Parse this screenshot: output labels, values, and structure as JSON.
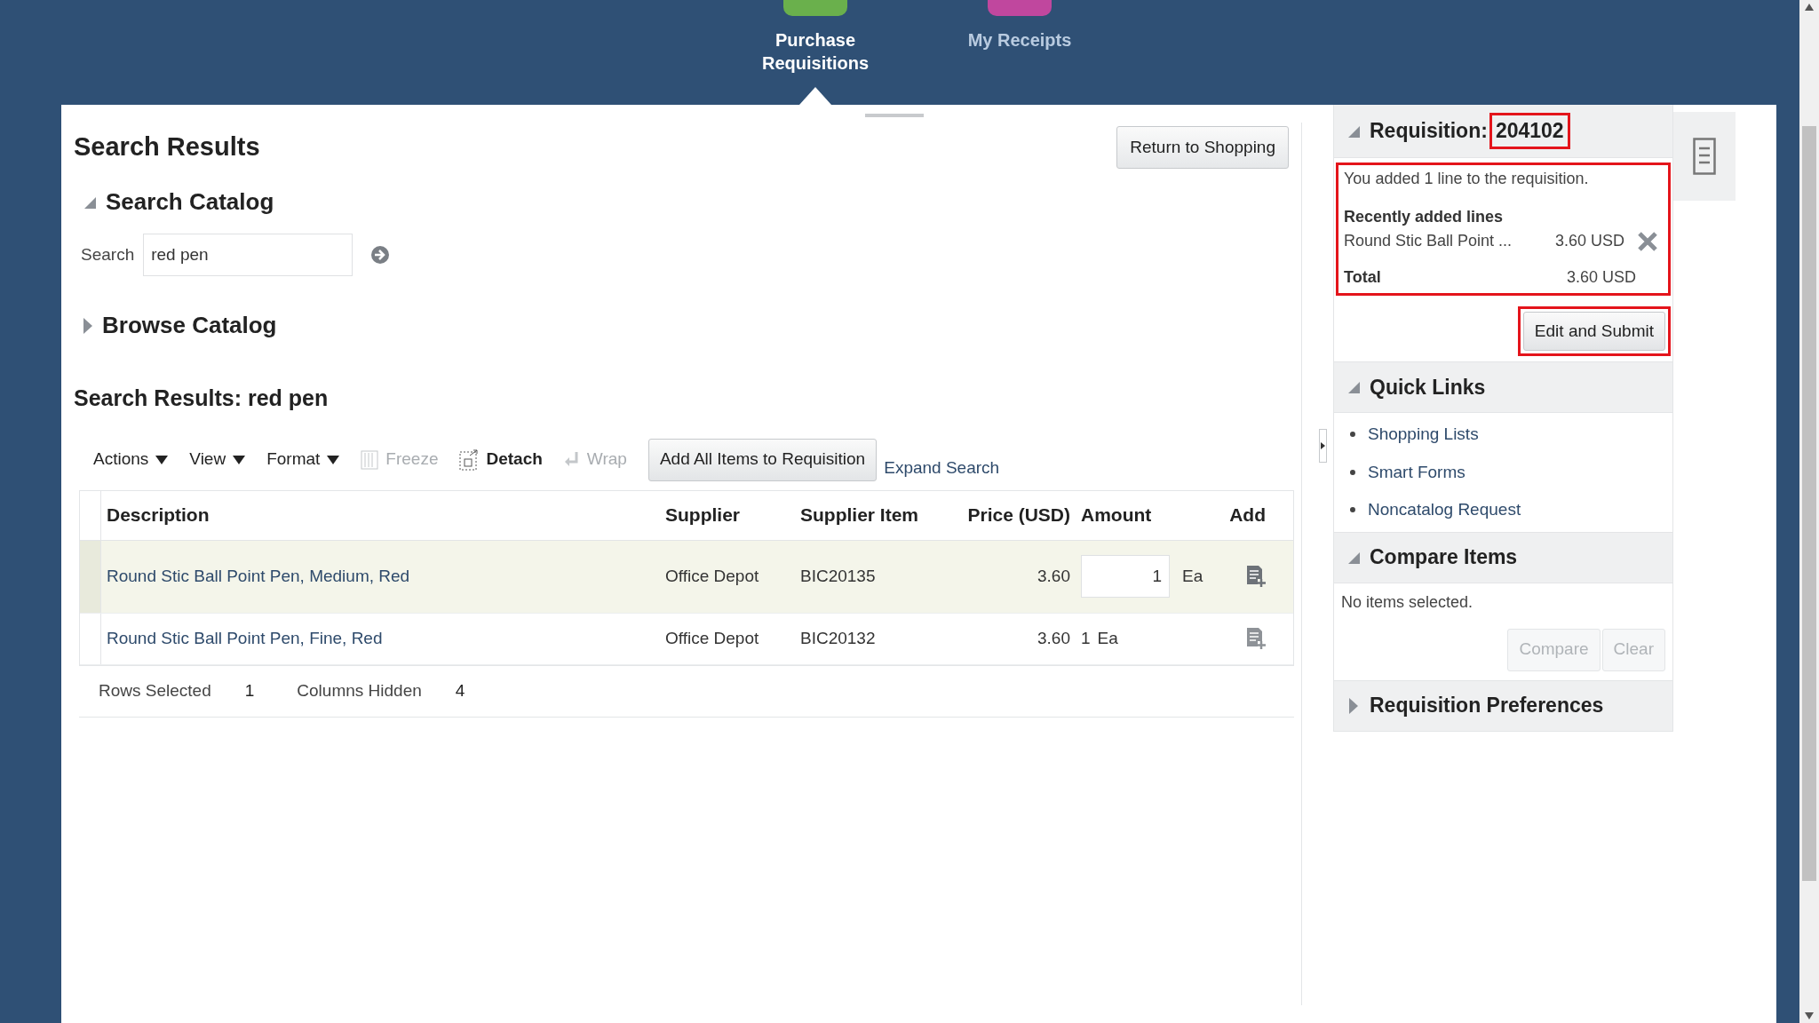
{
  "nav": {
    "items": [
      {
        "label": "Purchase Requisitions",
        "selected": true,
        "color": "#6ab04c"
      },
      {
        "label": "My Receipts",
        "selected": false,
        "color": "#c0479e"
      }
    ]
  },
  "main": {
    "title": "Search Results",
    "return_button": "Return to Shopping",
    "search_catalog": {
      "title": "Search Catalog",
      "expanded": true,
      "label": "Search",
      "value": "red pen"
    },
    "browse_catalog": {
      "title": "Browse Catalog",
      "expanded": false
    },
    "results": {
      "title": "Search Results: red pen",
      "toolbar": [
        {
          "kind": "menu",
          "label": "Actions",
          "disabled": false
        },
        {
          "kind": "menu",
          "label": "View",
          "disabled": false
        },
        {
          "kind": "menu",
          "label": "Format",
          "disabled": false
        },
        {
          "kind": "freeze",
          "label": "Freeze",
          "disabled": true
        },
        {
          "kind": "detach",
          "label": "Detach",
          "disabled": false
        },
        {
          "kind": "wrap",
          "label": "Wrap",
          "disabled": true
        }
      ],
      "add_all_button": "Add All Items to Requisition",
      "expand_link": "Expand Search",
      "columns": [
        "Description",
        "Supplier",
        "Supplier Item",
        "Price (USD)",
        "Amount",
        "Add"
      ],
      "rows": [
        {
          "description": "Round Stic Ball Point Pen, Medium, Red",
          "supplier": "Office Depot",
          "item": "BIC20135",
          "price": "3.60",
          "amount": "1",
          "uom": "Ea",
          "selected": true
        },
        {
          "description": "Round Stic Ball Point Pen, Fine, Red",
          "supplier": "Office Depot",
          "item": "BIC20132",
          "price": "3.60",
          "amount": "1",
          "uom": "Ea",
          "selected": false
        }
      ],
      "footer": [
        {
          "label": "Rows Selected",
          "value": "1"
        },
        {
          "label": "Columns Hidden",
          "value": "4"
        }
      ]
    }
  },
  "side": {
    "requisition": {
      "title": "Requisition:",
      "number": "204102",
      "expanded": true,
      "message": "You added 1 line to the requisition.",
      "recent_title": "Recently added lines",
      "lines": [
        {
          "name": "Round Stic Ball Point ...",
          "amount": "3.60 USD"
        }
      ],
      "total_label": "Total",
      "total": "3.60 USD",
      "button": "Edit and Submit"
    },
    "quick_links": {
      "title": "Quick Links",
      "expanded": true,
      "links": [
        "Shopping Lists",
        "Smart Forms",
        "Noncatalog Request"
      ]
    },
    "compare": {
      "title": "Compare Items",
      "expanded": true,
      "message": "No items selected.",
      "buttons": [
        {
          "label": "Compare",
          "disabled": true
        },
        {
          "label": "Clear",
          "disabled": true
        }
      ]
    },
    "preferences": {
      "title": "Requisition Preferences",
      "expanded": false
    }
  }
}
